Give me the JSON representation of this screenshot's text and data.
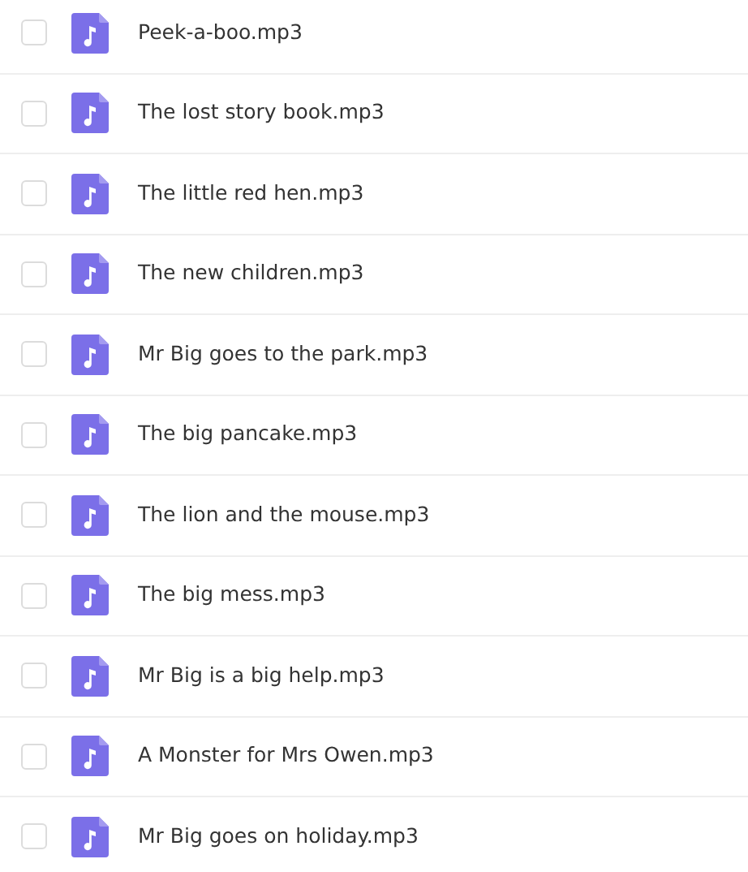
{
  "files": [
    {
      "name": "Peek-a-boo.mp3",
      "checked": false
    },
    {
      "name": "The lost story book.mp3",
      "checked": false
    },
    {
      "name": "The little red hen.mp3",
      "checked": false
    },
    {
      "name": "The new children.mp3",
      "checked": false
    },
    {
      "name": "Mr Big goes to the park.mp3",
      "checked": false
    },
    {
      "name": "The big pancake.mp3",
      "checked": false
    },
    {
      "name": "The lion and the mouse.mp3",
      "checked": false
    },
    {
      "name": "The big mess.mp3",
      "checked": false
    },
    {
      "name": "Mr Big is a big help.mp3",
      "checked": false
    },
    {
      "name": "A Monster for Mrs Owen.mp3",
      "checked": false
    },
    {
      "name": "Mr Big goes on holiday.mp3",
      "checked": false
    }
  ]
}
